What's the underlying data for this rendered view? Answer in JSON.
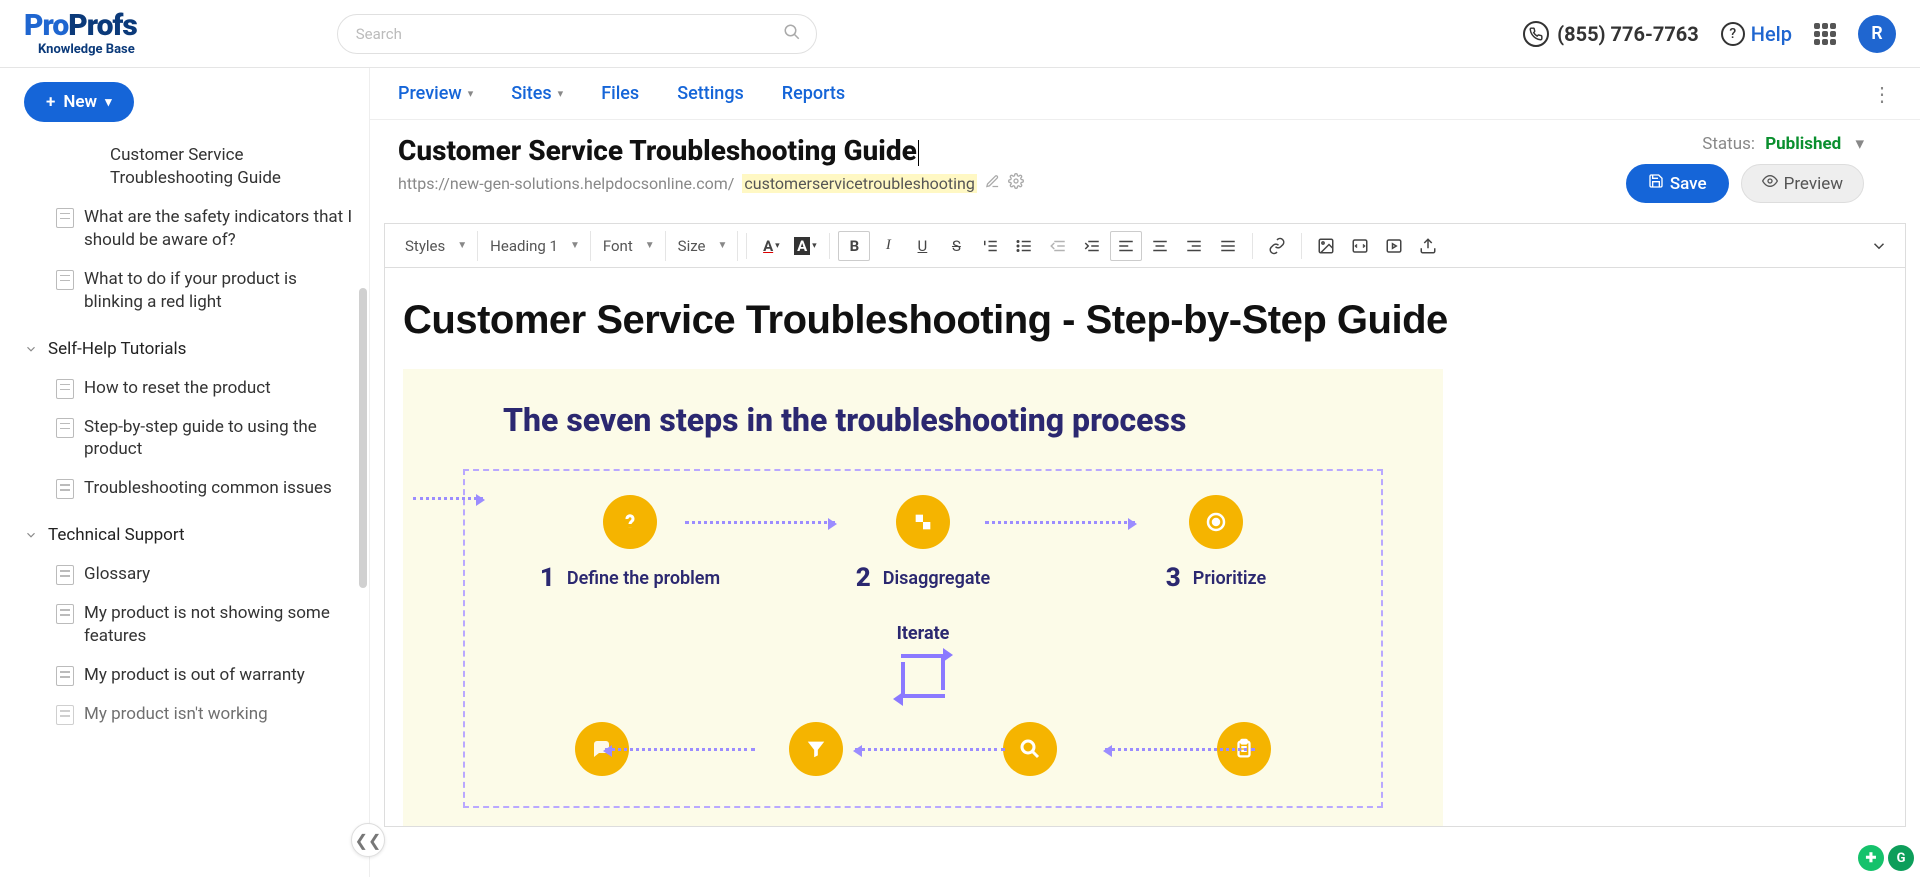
{
  "logo": {
    "pro": "Pro",
    "profs": "Profs",
    "sub": "Knowledge Base"
  },
  "search": {
    "placeholder": "Search"
  },
  "header": {
    "phone": "(855) 776-7763",
    "help": "Help",
    "avatar": "R"
  },
  "newBtn": {
    "label": "New"
  },
  "sidebar": {
    "items": [
      {
        "label": "Customer Service Troubleshooting Guide",
        "type": "plain"
      },
      {
        "label": "What are the safety indicators that I should be aware of?",
        "type": "doc"
      },
      {
        "label": "What to do if your product is blinking a red light",
        "type": "doc"
      }
    ],
    "group1": {
      "label": "Self-Help Tutorials"
    },
    "group1items": [
      {
        "label": "How to reset the product"
      },
      {
        "label": "Step-by-step guide to using the product"
      },
      {
        "label": "Troubleshooting common issues"
      }
    ],
    "group2": {
      "label": "Technical Support"
    },
    "group2items": [
      {
        "label": "Glossary"
      },
      {
        "label": "My product is not showing some features"
      },
      {
        "label": "My product is out of warranty"
      },
      {
        "label": "My product isn't working"
      }
    ]
  },
  "tabs": {
    "preview": "Preview",
    "sites": "Sites",
    "files": "Files",
    "settings": "Settings",
    "reports": "Reports"
  },
  "page": {
    "title": "Customer Service Troubleshooting Guide",
    "urlPrefix": "https://new-gen-solutions.helpdocsonline.com/",
    "urlSlug": "customerservicetroubleshooting",
    "statusLabel": "Status:",
    "statusValue": "Published",
    "save": "Save",
    "preview": "Preview"
  },
  "toolbar": {
    "styles": "Styles",
    "heading": "Heading 1",
    "font": "Font",
    "size": "Size"
  },
  "content": {
    "h1": "Customer Service Troubleshooting - Step-by-Step Guide",
    "diagramTitle": "The seven steps in the troubleshooting process",
    "steps": [
      {
        "n": "1",
        "label": "Define the problem"
      },
      {
        "n": "2",
        "label": "Disaggregate"
      },
      {
        "n": "3",
        "label": "Prioritize"
      }
    ],
    "iterate": "Iterate"
  }
}
